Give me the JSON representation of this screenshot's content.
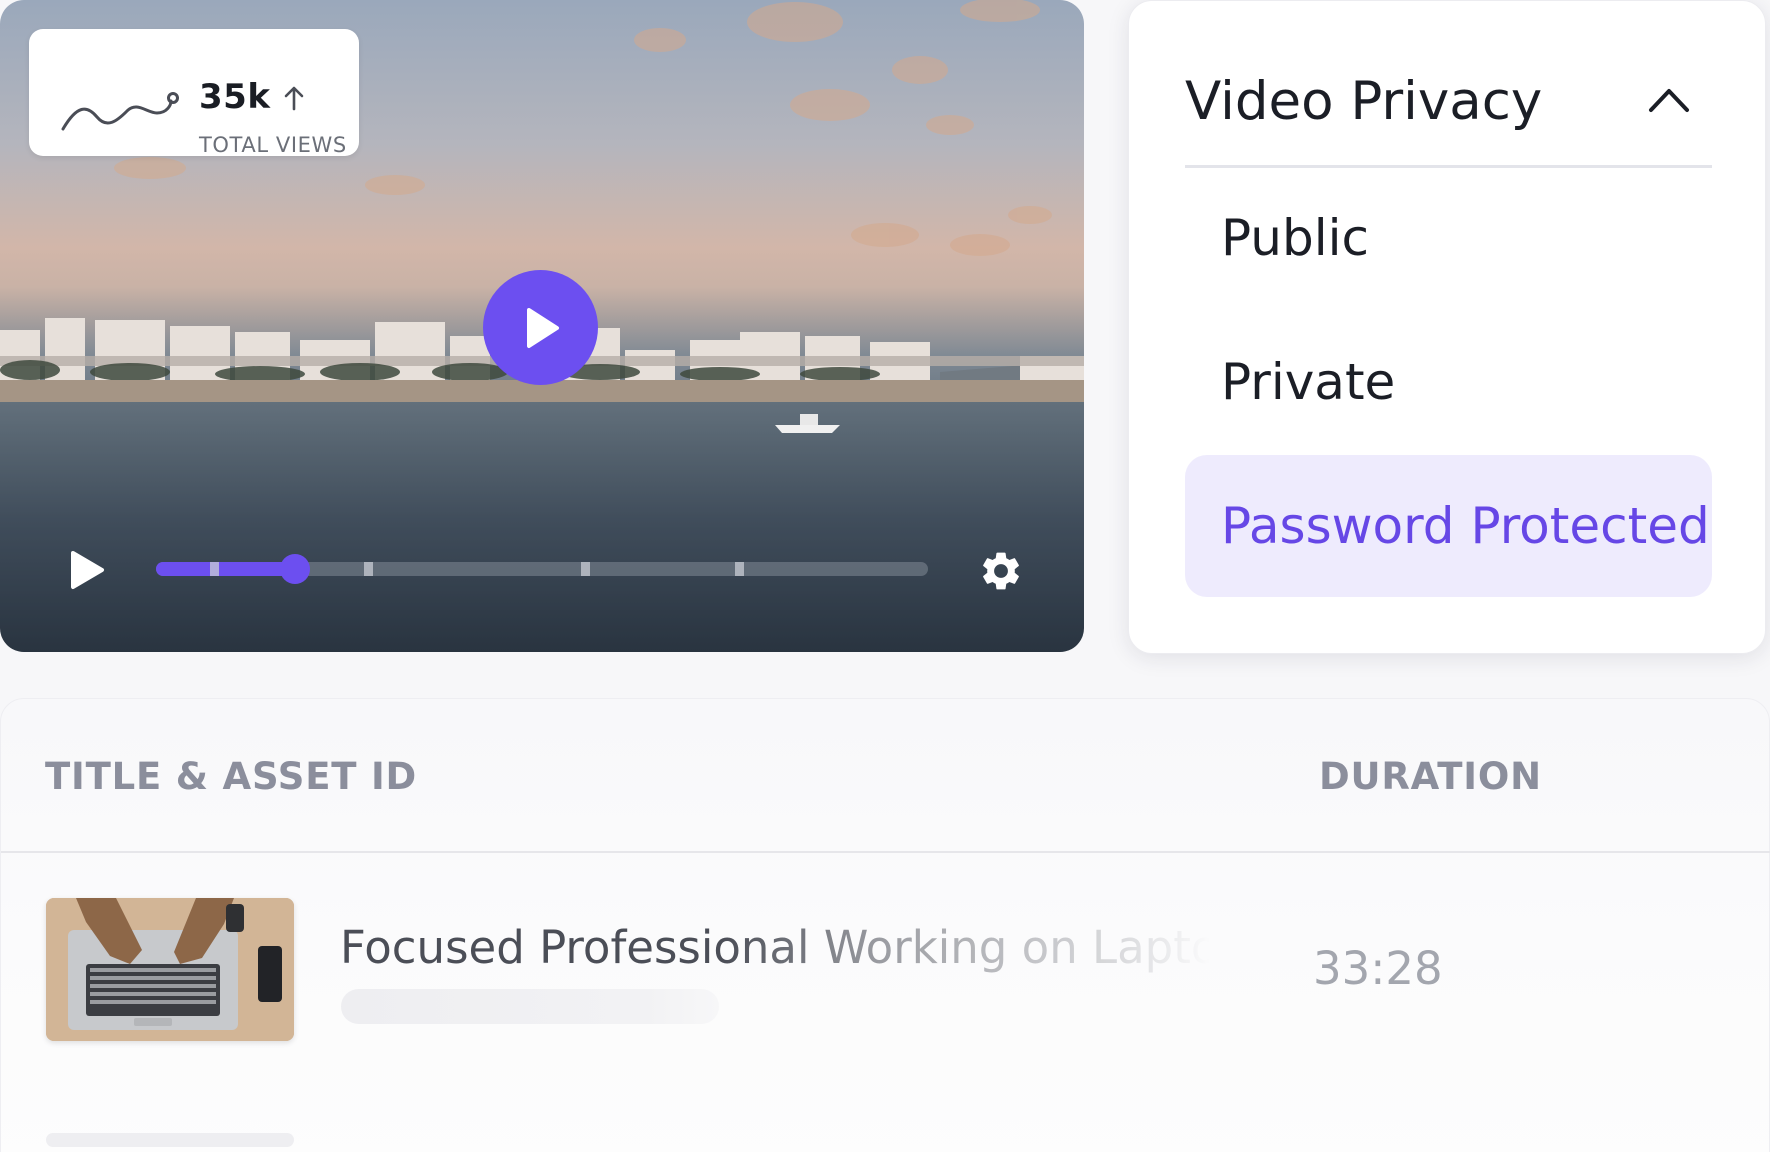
{
  "video": {
    "stats": {
      "value": "35k",
      "label": "TOTAL VIEWS",
      "trend_icon": "arrow-up-icon",
      "sparkline_icon": "sparkline-icon"
    },
    "progress_fraction": 0.18,
    "chapter_marks_fraction": [
      0.07,
      0.27,
      0.55,
      0.75
    ],
    "controls": {
      "play_icon": "play-icon",
      "settings_icon": "gear-icon"
    }
  },
  "privacy": {
    "title": "Video Privacy",
    "expanded": true,
    "options": [
      {
        "label": "Public",
        "selected": false
      },
      {
        "label": "Private",
        "selected": false
      },
      {
        "label": "Password Protected",
        "selected": true
      }
    ]
  },
  "table": {
    "columns": [
      "TITLE & ASSET ID",
      "DURATION"
    ],
    "rows": [
      {
        "title": "Focused Professional Working on Laptop...",
        "duration": "33:28"
      }
    ]
  },
  "colors": {
    "accent": "#6c4ff0",
    "selected_bg": "#eeebfd",
    "selected_text": "#6647e6"
  }
}
